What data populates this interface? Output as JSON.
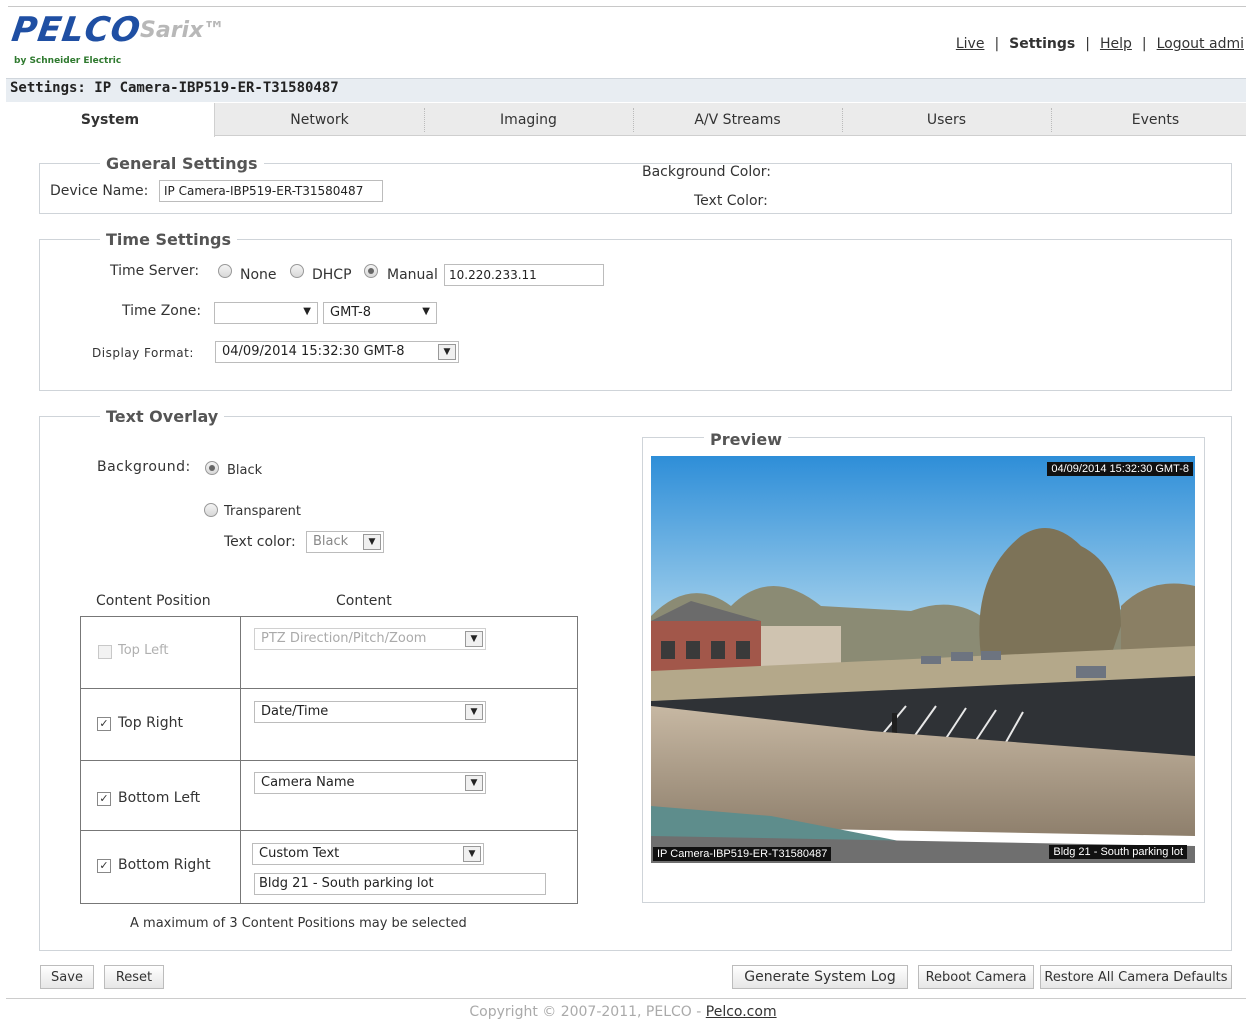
{
  "header": {
    "logo": "PELCO",
    "product": "Sarix™",
    "subbrand": "by Schneider Electric",
    "links": [
      "Live",
      "Settings",
      "Help",
      "Logout admi"
    ],
    "current_link": "Settings"
  },
  "settings_title": "Settings: IP Camera-IBP519-ER-T31580487",
  "tabs": [
    "System",
    "Network",
    "Imaging",
    "A/V Streams",
    "Users",
    "Events"
  ],
  "active_tab": "System",
  "general": {
    "legend": "General Settings",
    "device_name_label": "Device Name:",
    "device_name_value": "IP Camera-IBP519-ER-T31580487",
    "background_color_label": "Background Color:",
    "text_color_label": "Text Color:"
  },
  "time": {
    "legend": "Time Settings",
    "server_label": "Time Server:",
    "options": [
      "None",
      "DHCP",
      "Manual"
    ],
    "selected_option": "Manual",
    "server_value": "10.220.233.11",
    "zone_label": "Time Zone:",
    "zone_value": "",
    "zone_offset": "GMT-8",
    "display_format_label": "Display Format:",
    "display_format_value": "04/09/2014 15:32:30 GMT-8"
  },
  "overlay": {
    "legend": "Text Overlay",
    "background_label": "Background:",
    "background_options": [
      "Black",
      "Transparent"
    ],
    "background_selected": "Black",
    "text_color_label": "Text color:",
    "text_color_value": "Black",
    "col_position": "Content Position",
    "col_content": "Content",
    "rows": [
      {
        "position": "Top Left",
        "checked": false,
        "disabled": true,
        "content": "PTZ Direction/Pitch/Zoom"
      },
      {
        "position": "Top Right",
        "checked": true,
        "disabled": false,
        "content": "Date/Time"
      },
      {
        "position": "Bottom Left",
        "checked": true,
        "disabled": false,
        "content": "Camera Name"
      },
      {
        "position": "Bottom Right",
        "checked": true,
        "disabled": false,
        "content": "Custom Text",
        "custom_text": "Bldg 21 - South parking lot"
      }
    ],
    "note": "A maximum of 3 Content Positions may be selected"
  },
  "preview": {
    "legend": "Preview",
    "overlay_top_right": "04/09/2014 15:32:30 GMT-8",
    "overlay_bottom_left": "IP Camera-IBP519-ER-T31580487",
    "overlay_bottom_right": "Bldg 21 - South parking lot"
  },
  "buttons": {
    "save": "Save",
    "reset": "Reset",
    "generate_log": "Generate System Log",
    "reboot": "Reboot Camera",
    "restore": "Restore All Camera Defaults"
  },
  "footer": {
    "copyright": "Copyright © 2007-2011, PELCO -",
    "link": "Pelco.com"
  }
}
